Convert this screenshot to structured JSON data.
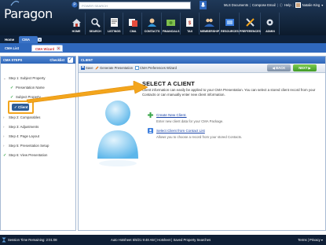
{
  "app": {
    "logo": "Paragon"
  },
  "topbar": {
    "search_placeholder": "POWER SEARCH",
    "mls_documents": "MLS Documents",
    "compose_email": "Compose Email",
    "help": "Help",
    "user_name": "Natalie King"
  },
  "nav": [
    {
      "label": "HOME",
      "icon": "home-icon"
    },
    {
      "label": "SEARCH",
      "icon": "search-icon"
    },
    {
      "label": "LISTINGS",
      "icon": "listings-icon"
    },
    {
      "label": "CMA",
      "icon": "cma-icon"
    },
    {
      "label": "CONTACTS",
      "icon": "contacts-icon"
    },
    {
      "label": "FINANCIALS",
      "icon": "financials-icon"
    },
    {
      "label": "TAX",
      "icon": "tax-icon"
    },
    {
      "label": "MEMBERSHIP",
      "icon": "membership-icon"
    },
    {
      "label": "RESOURCES",
      "icon": "resources-icon"
    },
    {
      "label": "PREFERENCES",
      "icon": "preferences-icon"
    },
    {
      "label": "ADMIN",
      "icon": "admin-icon"
    }
  ],
  "tabs": {
    "home": "Home",
    "cma": "CMA",
    "cma_list": "CMA List",
    "cma_wizard": "CMA Wizard"
  },
  "left_panel": {
    "title": "CMA STEPS",
    "checklist": "Checklist",
    "steps": [
      {
        "label": "Step 1: Subject Property"
      },
      {
        "label": "Presentation Name"
      },
      {
        "label": "Subject Property"
      },
      {
        "label": "Client"
      },
      {
        "label": "Step 2: Comparables"
      },
      {
        "label": "Step 3: Adjustments"
      },
      {
        "label": "Step 4: Page Layout"
      },
      {
        "label": "Step 5: Presentation Setup"
      },
      {
        "label": "Step 6: View Presentation"
      }
    ]
  },
  "right_panel": {
    "title": "CLIENT",
    "toolbar": {
      "save": "Save",
      "generate": "Generate Presentation",
      "preferences": "CMA Preferences Wizard",
      "back": "BACK",
      "next": "NEXT"
    },
    "heading": "SELECT A CLIENT",
    "description": "Client information can easily be applied to your CMA Presentation. You can select a stored client record from your Contacts or can manually enter new client information.",
    "option1_link": "Create New Client.",
    "option1_desc": "Enter new client data for your CMA Package.",
    "option2_link": "Select Client from Contact List",
    "option2_desc": "Allows you to choose a record from your stored Contacts."
  },
  "footer": {
    "session": "Session Time Remaining: 2:01:08",
    "autohotsheet": "Auto Hotsheet 5/6/21 9:48 AM  |  Hotsheet  |  Saved Property Searches",
    "terms": "Terms  |  Privacy"
  },
  "colors": {
    "header": "#13263f",
    "tab_blue": "#2f68bd",
    "accent_orange": "#f3a51c",
    "next_green": "#4caf2f",
    "link": "#1a44a8"
  }
}
